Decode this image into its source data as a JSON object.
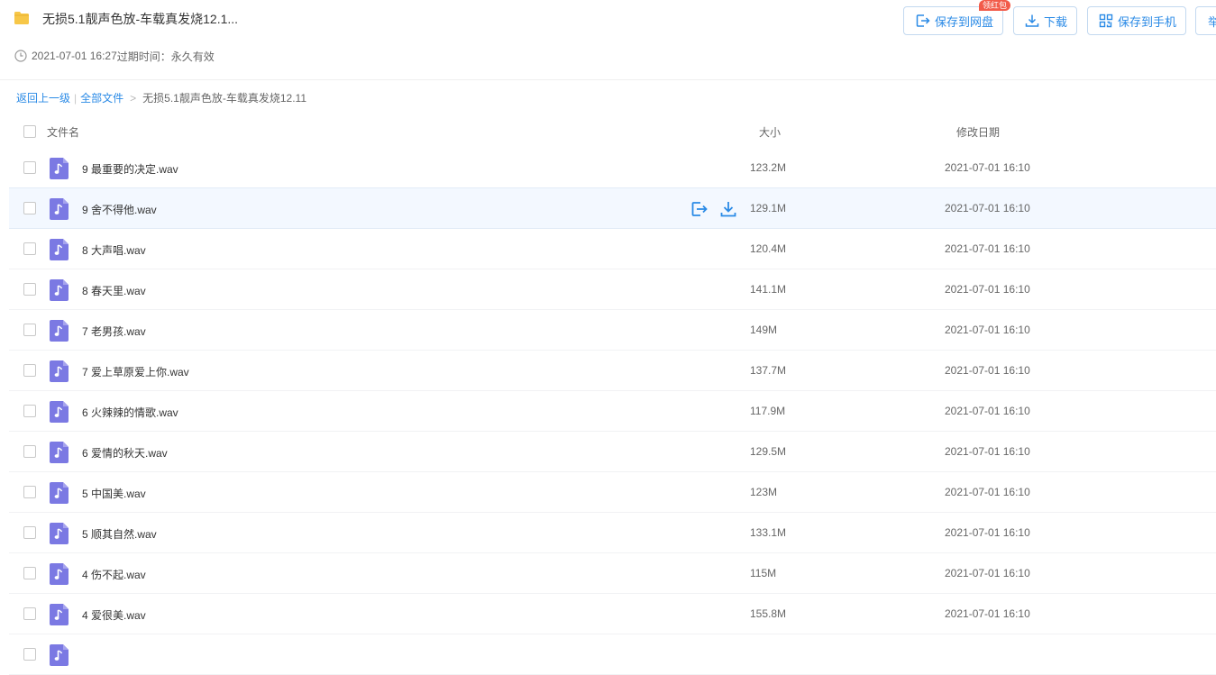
{
  "header": {
    "title": "无损5.1靓声色放-车载真发烧12.1...",
    "date": "2021-07-01 16:27",
    "expire_label": "过期时间：",
    "expire_value": "永久有效",
    "badge": "领红包",
    "buttons": {
      "save_to_disk": "保存到网盘",
      "download": "下载",
      "save_to_phone": "保存到手机",
      "more": "举"
    }
  },
  "breadcrumb": {
    "back": "返回上一级",
    "all_files": "全部文件",
    "current": "无损5.1靓声色放-车载真发烧12.11"
  },
  "table": {
    "columns": {
      "name": "文件名",
      "size": "大小",
      "date": "修改日期"
    },
    "rows": [
      {
        "name": "9 最重要的决定.wav",
        "size": "123.2M",
        "date": "2021-07-01 16:10"
      },
      {
        "name": "9 舍不得他.wav",
        "size": "129.1M",
        "date": "2021-07-01 16:10"
      },
      {
        "name": "8 大声唱.wav",
        "size": "120.4M",
        "date": "2021-07-01 16:10"
      },
      {
        "name": "8 春天里.wav",
        "size": "141.1M",
        "date": "2021-07-01 16:10"
      },
      {
        "name": "7 老男孩.wav",
        "size": "149M",
        "date": "2021-07-01 16:10"
      },
      {
        "name": "7 爱上草原爱上你.wav",
        "size": "137.7M",
        "date": "2021-07-01 16:10"
      },
      {
        "name": "6 火辣辣的情歌.wav",
        "size": "117.9M",
        "date": "2021-07-01 16:10"
      },
      {
        "name": "6 爱情的秋天.wav",
        "size": "129.5M",
        "date": "2021-07-01 16:10"
      },
      {
        "name": "5 中国美.wav",
        "size": "123M",
        "date": "2021-07-01 16:10"
      },
      {
        "name": "5 顺其自然.wav",
        "size": "133.1M",
        "date": "2021-07-01 16:10"
      },
      {
        "name": "4 伤不起.wav",
        "size": "115M",
        "date": "2021-07-01 16:10"
      },
      {
        "name": "4 爱很美.wav",
        "size": "155.8M",
        "date": "2021-07-01 16:10"
      },
      {
        "name": "",
        "size": "",
        "date": ""
      }
    ]
  },
  "colors": {
    "accent": "#2a8ae6",
    "file_icon": "#7b79e3",
    "folder": "#f7c748",
    "badge": "#f25b4a",
    "hover_row": "#f3f8ff"
  },
  "icons": {
    "folder": "folder-icon",
    "clock": "clock-icon",
    "audio_file": "audio-file-icon",
    "save": "save-to-disk-icon",
    "download": "download-icon",
    "phone": "qr-phone-icon"
  }
}
